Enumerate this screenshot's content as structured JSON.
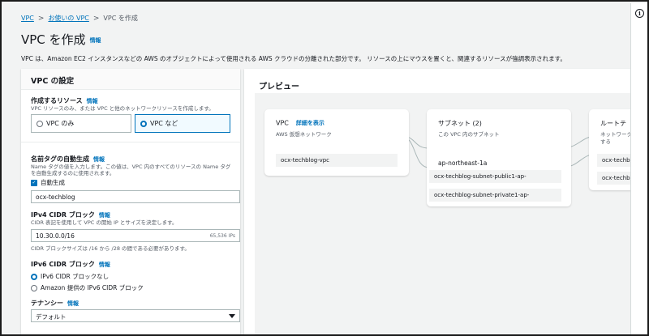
{
  "breadcrumb": {
    "item1": "VPC",
    "item2": "お使いの VPC",
    "item3": "VPC を作成"
  },
  "page": {
    "title": "VPC を作成",
    "info": "情報",
    "description": "VPC は、Amazon EC2 インスタンスなどの AWS のオブジェクトによって使用される AWS クラウドの分離された部分です。 リソースの上にマウスを置くと、関連するリソースが強調表示されます。"
  },
  "settings": {
    "header": "VPC の設定",
    "resources_label": "作成するリソース",
    "resources_info": "情報",
    "resources_desc": "VPC リソースのみ、または VPC と他のネットワークリソースを作成します。",
    "option_vpc_only": "VPC のみ",
    "option_vpc_etc": "VPC など",
    "name_tag_label": "名前タグの自動生成",
    "name_tag_info": "情報",
    "name_tag_desc1": "Name タグの値を入力します。この値は、VPC 内のすべてのリソースの Name タグ",
    "name_tag_desc2": "を自動生成するのに使用されます。",
    "auto_generate": "自動生成",
    "name_value": "ocx-techblog",
    "ipv4_label": "IPv4 CIDR ブロック",
    "ipv4_info": "情報",
    "ipv4_desc": "CIDR 表記を使用して VPC の開始 IP とサイズを決定します。",
    "ipv4_value": "10.30.0.0/16",
    "ipv4_hint": "65,536 IPs",
    "ipv4_constraint": "CIDR ブロックサイズは /16 から /28 の間である必要があります。",
    "ipv6_label": "IPv6 CIDR ブロック",
    "ipv6_info": "情報",
    "ipv6_none": "IPv6 CIDR ブロックなし",
    "ipv6_amazon": "Amazon 提供の IPv6 CIDR ブロック",
    "tenancy_label": "テナンシー",
    "tenancy_info": "情報",
    "tenancy_value": "デフォルト"
  },
  "preview": {
    "header": "プレビュー",
    "vpc": {
      "title": "VPC",
      "link": "詳細を表示",
      "sub": "AWS 仮想ネットワーク",
      "item": "ocx-techblog-vpc"
    },
    "subnets": {
      "title": "サブネット (2)",
      "sub": "この VPC 内のサブネット",
      "az": "ap-northeast-1a",
      "items": [
        "ocx-techblog-subnet-public1-ap-",
        "ocx-techblog-subnet-private1-ap-"
      ]
    },
    "routes": {
      "title": "ルートテ",
      "sub1": "ネットワーク",
      "sub2": "する",
      "items": [
        "ocx-techbl",
        "ocx-techbl"
      ]
    }
  }
}
